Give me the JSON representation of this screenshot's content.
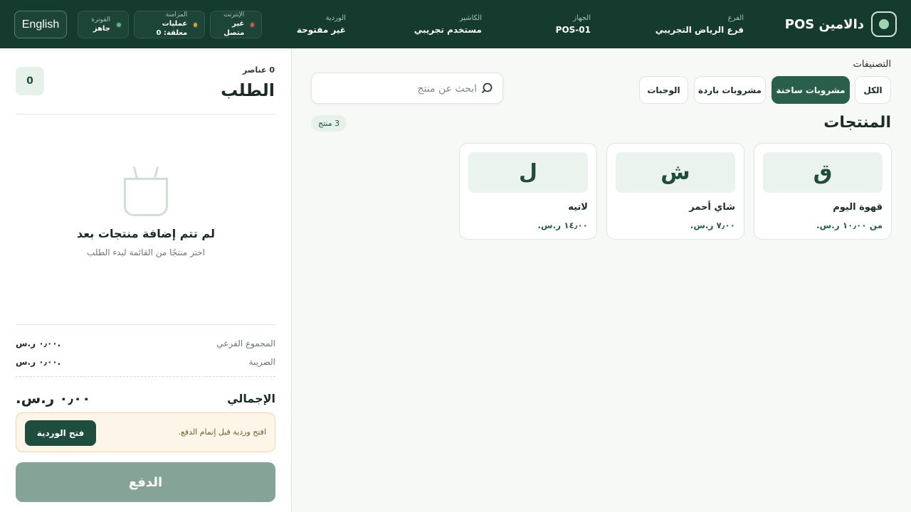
{
  "header": {
    "brand": "دالامين POS",
    "branch": {
      "label": "الفرع",
      "value": "فرع الرياض التجريبي"
    },
    "device": {
      "label": "الجهاز",
      "value": "POS-01"
    },
    "cashier": {
      "label": "الكاشير",
      "value": "مستخدم تجريبي"
    },
    "shift": {
      "label": "الوردية",
      "value": "غير مفتوحة"
    },
    "status": [
      {
        "label": "الإنترنت",
        "value": "غير متصل",
        "color": "#e05252"
      },
      {
        "label": "المزامنة",
        "value": "عمليات معلقة: 0",
        "color": "#e0a030"
      },
      {
        "label": "الفوترة",
        "value": "جاهز",
        "color": "#5cb87a"
      }
    ],
    "language_button": "English"
  },
  "order": {
    "items_count": "0 عناصر",
    "title": "الطلب",
    "badge": "0",
    "empty_title": "لم تتم إضافة منتجات بعد",
    "empty_subtitle": "اختر منتجًا من القائمة لبدء الطلب",
    "subtotal": {
      "label": "المجموع الفرعي",
      "value": "٠٫٠٠ ر.س."
    },
    "tax": {
      "label": "الضريبة",
      "value": "٠٫٠٠ ر.س."
    },
    "total": {
      "label": "الإجمالي",
      "value": "٠٫٠٠ ر.س."
    },
    "shift_notice": "افتح وردية قبل إتمام الدفع.",
    "open_shift_button": "فتح الوردية",
    "pay_button": "الدفع"
  },
  "catalog": {
    "categories_label": "التصنيفات",
    "categories": [
      "الكل",
      "مشروبات ساخنة",
      "مشروبات باردة",
      "الوجبات"
    ],
    "active_category": "مشروبات ساخنة",
    "search_placeholder": "ابحث عن منتج",
    "products_title": "المنتجات",
    "products_count": "3 منتج",
    "products": [
      {
        "letter": "ق",
        "name": "قهوة اليوم",
        "price": "من ١٠٫٠٠ ر.س."
      },
      {
        "letter": "ش",
        "name": "شاي أحمر",
        "price": "٧٫٠٠ ر.س."
      },
      {
        "letter": "ل",
        "name": "لاتيه",
        "price": "١٤٫٠٠ ر.س."
      }
    ]
  }
}
